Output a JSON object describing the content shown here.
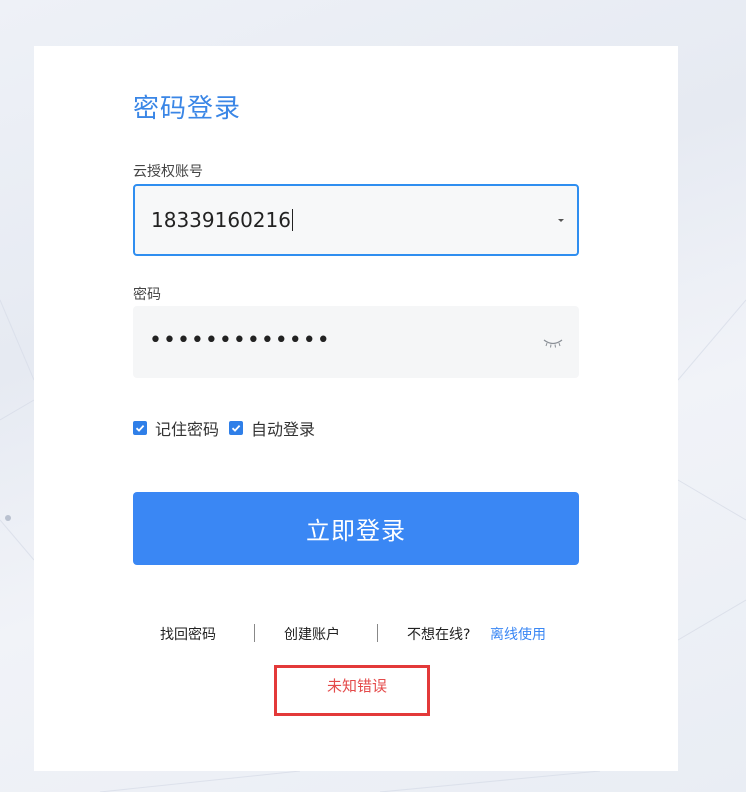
{
  "login": {
    "title": "密码登录",
    "account_label": "云授权账号",
    "account_value": "18339160216",
    "password_label": "密码",
    "password_masked": "•••••••••••••",
    "remember_password": "记住密码",
    "auto_login": "自动登录",
    "submit_label": "立即登录"
  },
  "footer_links": {
    "forgot_password": "找回密码",
    "create_account": "创建账户",
    "offline_prompt": "不想在线?",
    "offline_use": "离线使用"
  },
  "error": {
    "message": "未知错误"
  },
  "colors": {
    "accent": "#3a87f4",
    "title": "#3a86e6",
    "error": "#e33939"
  }
}
